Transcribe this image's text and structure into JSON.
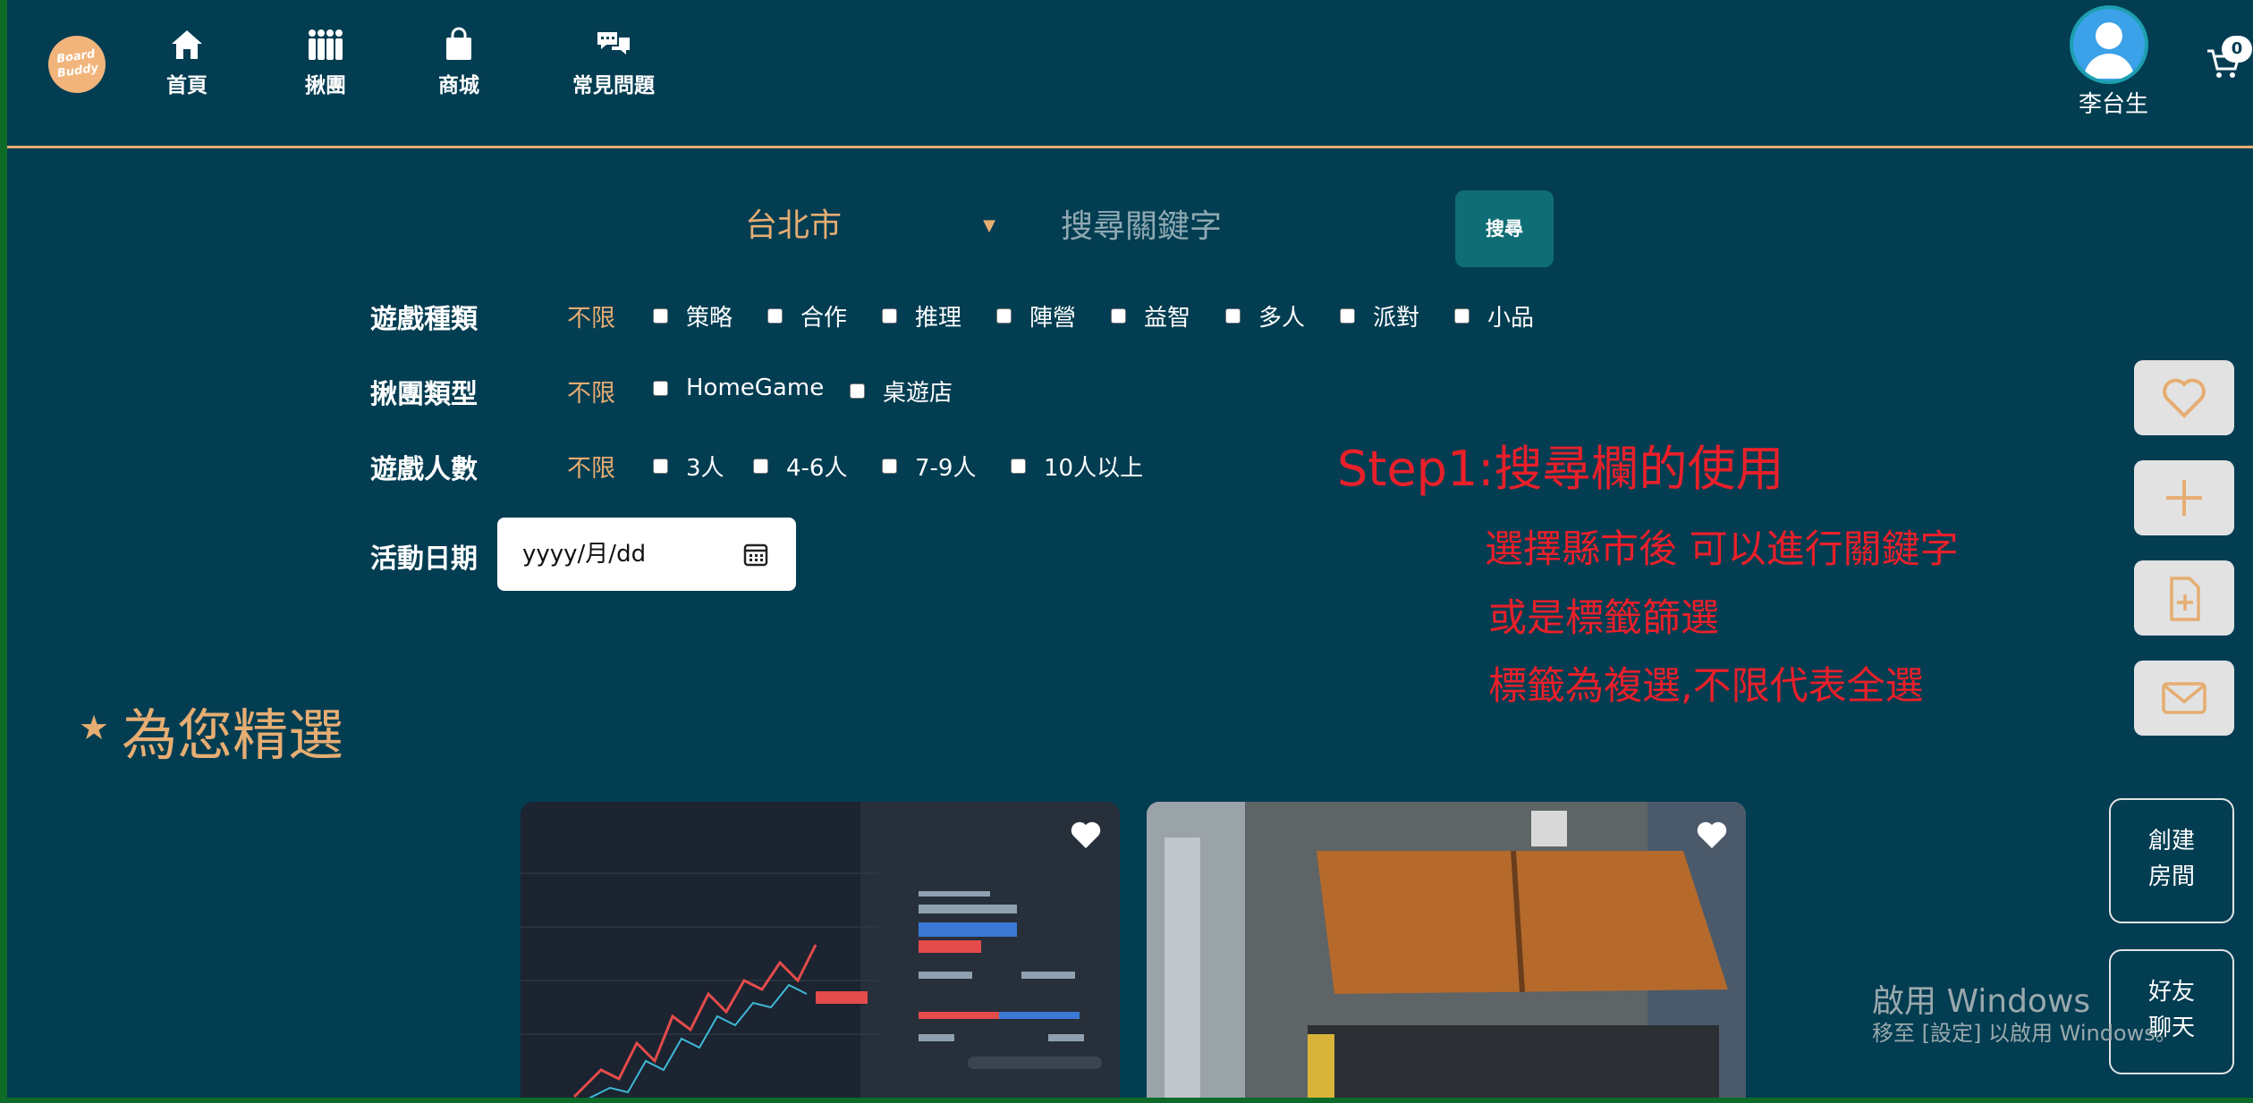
{
  "nav": {
    "logo_text": "Board Buddy",
    "items": [
      {
        "label": "首頁",
        "icon": "home-icon"
      },
      {
        "label": "揪團",
        "icon": "group-icon"
      },
      {
        "label": "商城",
        "icon": "shopping-bag-icon"
      },
      {
        "label": "常見問題",
        "icon": "faq-chat-icon"
      }
    ],
    "user_name": "李台生",
    "cart_count": "0"
  },
  "search": {
    "city_value": "台北市",
    "placeholder": "搜尋關鍵字",
    "button_label": "搜尋"
  },
  "filters": {
    "any_label": "不限",
    "game_type": {
      "label": "遊戲種類",
      "options": [
        "策略",
        "合作",
        "推理",
        "陣營",
        "益智",
        "多人",
        "派對",
        "小品"
      ]
    },
    "group_type": {
      "label": "揪團類型",
      "options": [
        "HomeGame",
        "桌遊店"
      ]
    },
    "player_count": {
      "label": "遊戲人數",
      "options": [
        "3人",
        "4-6人",
        "7-9人",
        "10人以上"
      ]
    },
    "date": {
      "label": "活動日期",
      "placeholder": "yyyy/月/dd"
    }
  },
  "annotation": {
    "title": "Step1:搜尋欄的使用",
    "lines": [
      "選擇縣市後 可以進行關鍵字",
      "或是標籤篩選",
      "標籤為複選,不限代表全選"
    ]
  },
  "featured": {
    "star": "★",
    "title": "為您精選"
  },
  "side_actions": [
    "favorite-heart-icon",
    "add-plus-icon",
    "add-document-icon",
    "mail-icon"
  ],
  "floating": {
    "create_room": [
      "創建",
      "房間"
    ],
    "friend_chat": [
      "好友",
      "聊天"
    ]
  },
  "windows_watermark": {
    "line1": "啟用 Windows",
    "line2": "移至 [設定] 以啟用 Windows。"
  },
  "colors": {
    "background": "#023d52",
    "accent": "#e6ad72",
    "annotation": "#e8202a",
    "search_button": "#0f6d75"
  }
}
